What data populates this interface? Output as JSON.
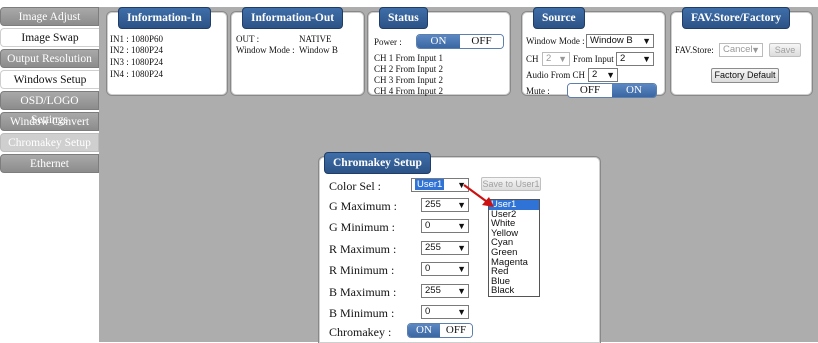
{
  "sidebar": {
    "items": [
      {
        "label": "Image Adjust",
        "style": "gray"
      },
      {
        "label": "Image Swap",
        "style": "white"
      },
      {
        "label": "Output Resolution",
        "style": "gray"
      },
      {
        "label": "Windows Setup",
        "style": "white"
      },
      {
        "label": "OSD/LOGO Settings",
        "style": "gray"
      },
      {
        "label": "Window Convert",
        "style": "gray"
      },
      {
        "label": "Chromakey Setup",
        "style": "light"
      },
      {
        "label": "Ethernet",
        "style": "gray"
      }
    ]
  },
  "info_in": {
    "title": "Information-In",
    "lines": [
      "IN1 : 1080P60",
      "IN2 : 1080P24",
      "IN3 : 1080P24",
      "IN4 : 1080P24"
    ]
  },
  "info_out": {
    "title": "Information-Out",
    "out_label": "OUT :",
    "out_value": "NATIVE",
    "mode_label": "Window Mode :",
    "mode_value": "Window B"
  },
  "status": {
    "title": "Status",
    "power_label": "Power :",
    "on": "ON",
    "off": "OFF",
    "channels": [
      "CH 1 From Input   1",
      "CH 2 From Input   2",
      "CH 3 From Input   2",
      "CH 4 From Input   2"
    ]
  },
  "source": {
    "title": "Source",
    "window_mode_label": "Window Mode :",
    "window_mode_value": "Window B",
    "ch_label": "CH",
    "ch_value": "2",
    "from_input_label": "From Input",
    "from_input_value": "2",
    "audio_label": "Audio From CH",
    "audio_value": "2",
    "mute_label": "Mute :",
    "off": "OFF",
    "on": "ON"
  },
  "fav": {
    "title": "FAV.Store/Factory",
    "store_label": "FAV.Store:",
    "store_value": "Cancel",
    "save": "Save",
    "factory": "Factory Default"
  },
  "chroma": {
    "title": "Chromakey Setup",
    "color_sel_label": "Color Sel :",
    "color_sel_value": "User1",
    "save_to": "Save to User1",
    "rows": [
      {
        "label": "G Maximum :",
        "value": "255"
      },
      {
        "label": "G Minimum :",
        "value": "0"
      },
      {
        "label": "R Maximum :",
        "value": "255"
      },
      {
        "label": "R Minimum :",
        "value": "0"
      },
      {
        "label": "B Maximum :",
        "value": "255"
      },
      {
        "label": "B Minimum :",
        "value": "0"
      }
    ],
    "chromakey_label": "Chromakey :",
    "on": "ON",
    "off": "OFF",
    "options": [
      "User1",
      "User2",
      "White",
      "Yellow",
      "Cyan",
      "Green",
      "Magenta",
      "Red",
      "Blue",
      "Black"
    ]
  },
  "colors": {
    "accent": "#3a66a2",
    "panel_bg": "#adadad",
    "highlight": "#2f73d6",
    "arrow": "#cc1111"
  }
}
